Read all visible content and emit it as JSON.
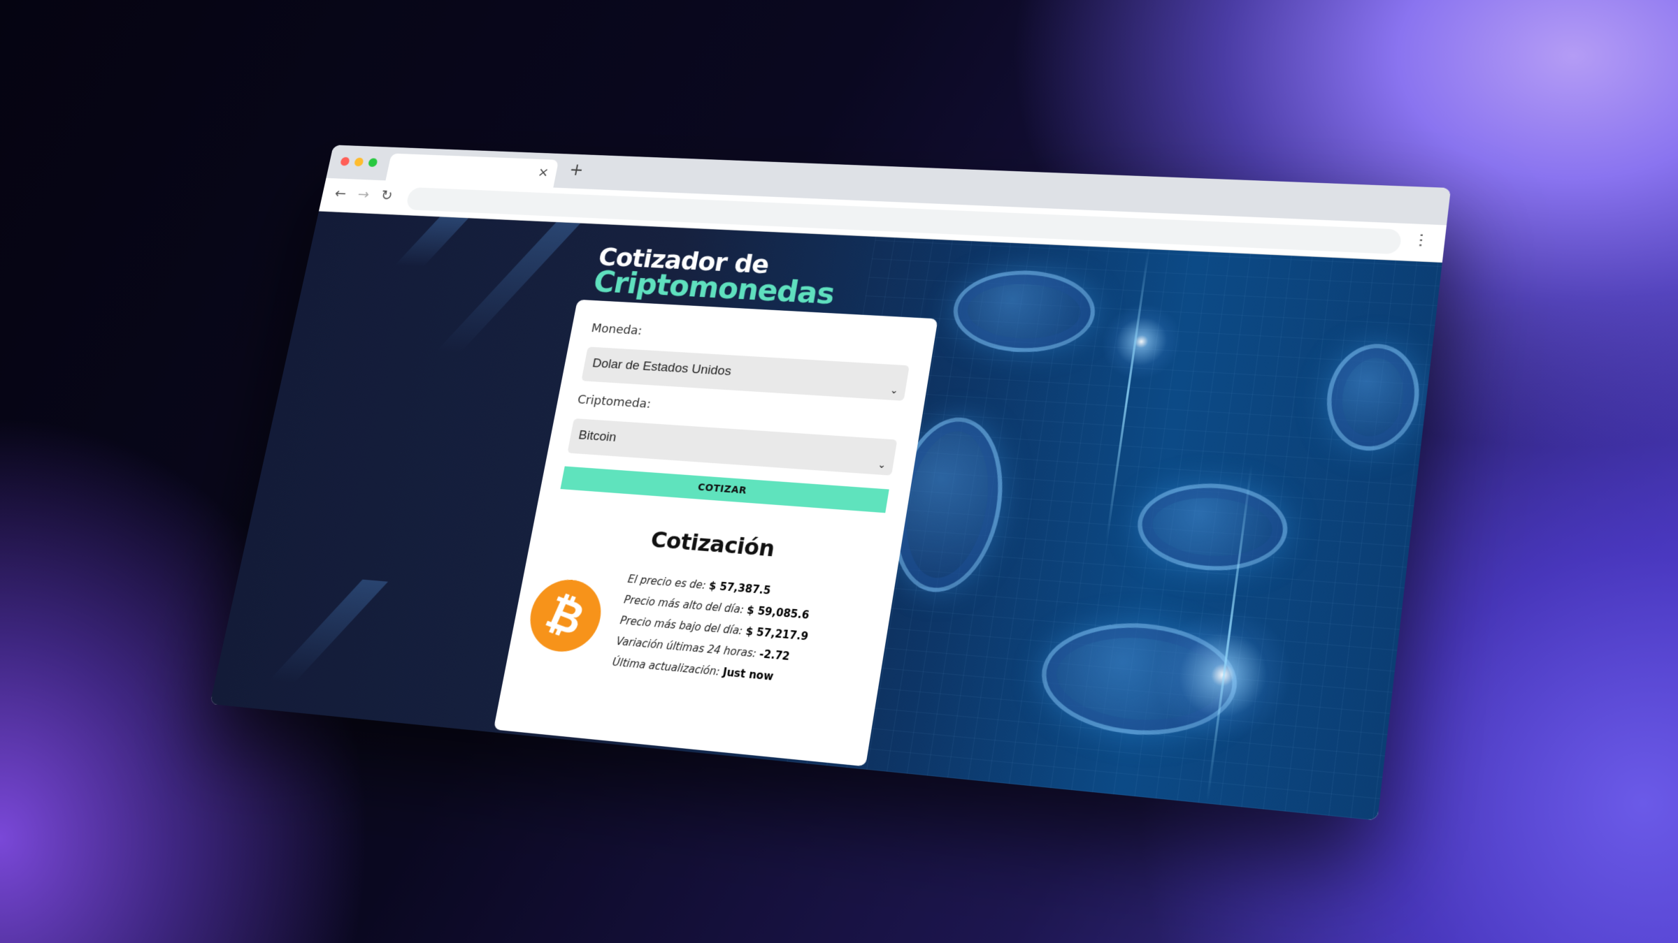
{
  "browser": {
    "tab_title": "",
    "tab_close_glyph": "×",
    "new_tab_glyph": "+",
    "back_glyph": "←",
    "forward_glyph": "→",
    "reload_glyph": "↻",
    "url": "",
    "menu_glyph": "⋯",
    "traffic_lights": [
      "#ff5f57",
      "#febc2e",
      "#28c840"
    ]
  },
  "app": {
    "title_line1": "Cotizador de",
    "title_line2": "Criptomonedas",
    "accent_color": "#5fe3bd"
  },
  "form": {
    "currency_label": "Moneda:",
    "currency_value": "Dolar de Estados Unidos",
    "crypto_label": "Criptomeda:",
    "crypto_value": "Bitcoin",
    "submit_label": "COTIZAR"
  },
  "quote": {
    "heading": "Cotización",
    "coin_icon": "bitcoin-icon",
    "coin_symbol": "₿",
    "rows": [
      {
        "label": "El precio es de: ",
        "value": "$ 57,387.5"
      },
      {
        "label": "Precio más alto del día: ",
        "value": "$ 59,085.6"
      },
      {
        "label": "Precio más bajo del día: ",
        "value": "$ 57,217.9"
      },
      {
        "label": "Variación últimas 24 horas: ",
        "value": "-2.72"
      },
      {
        "label": "Última actualización: ",
        "value": "Just now"
      }
    ]
  }
}
